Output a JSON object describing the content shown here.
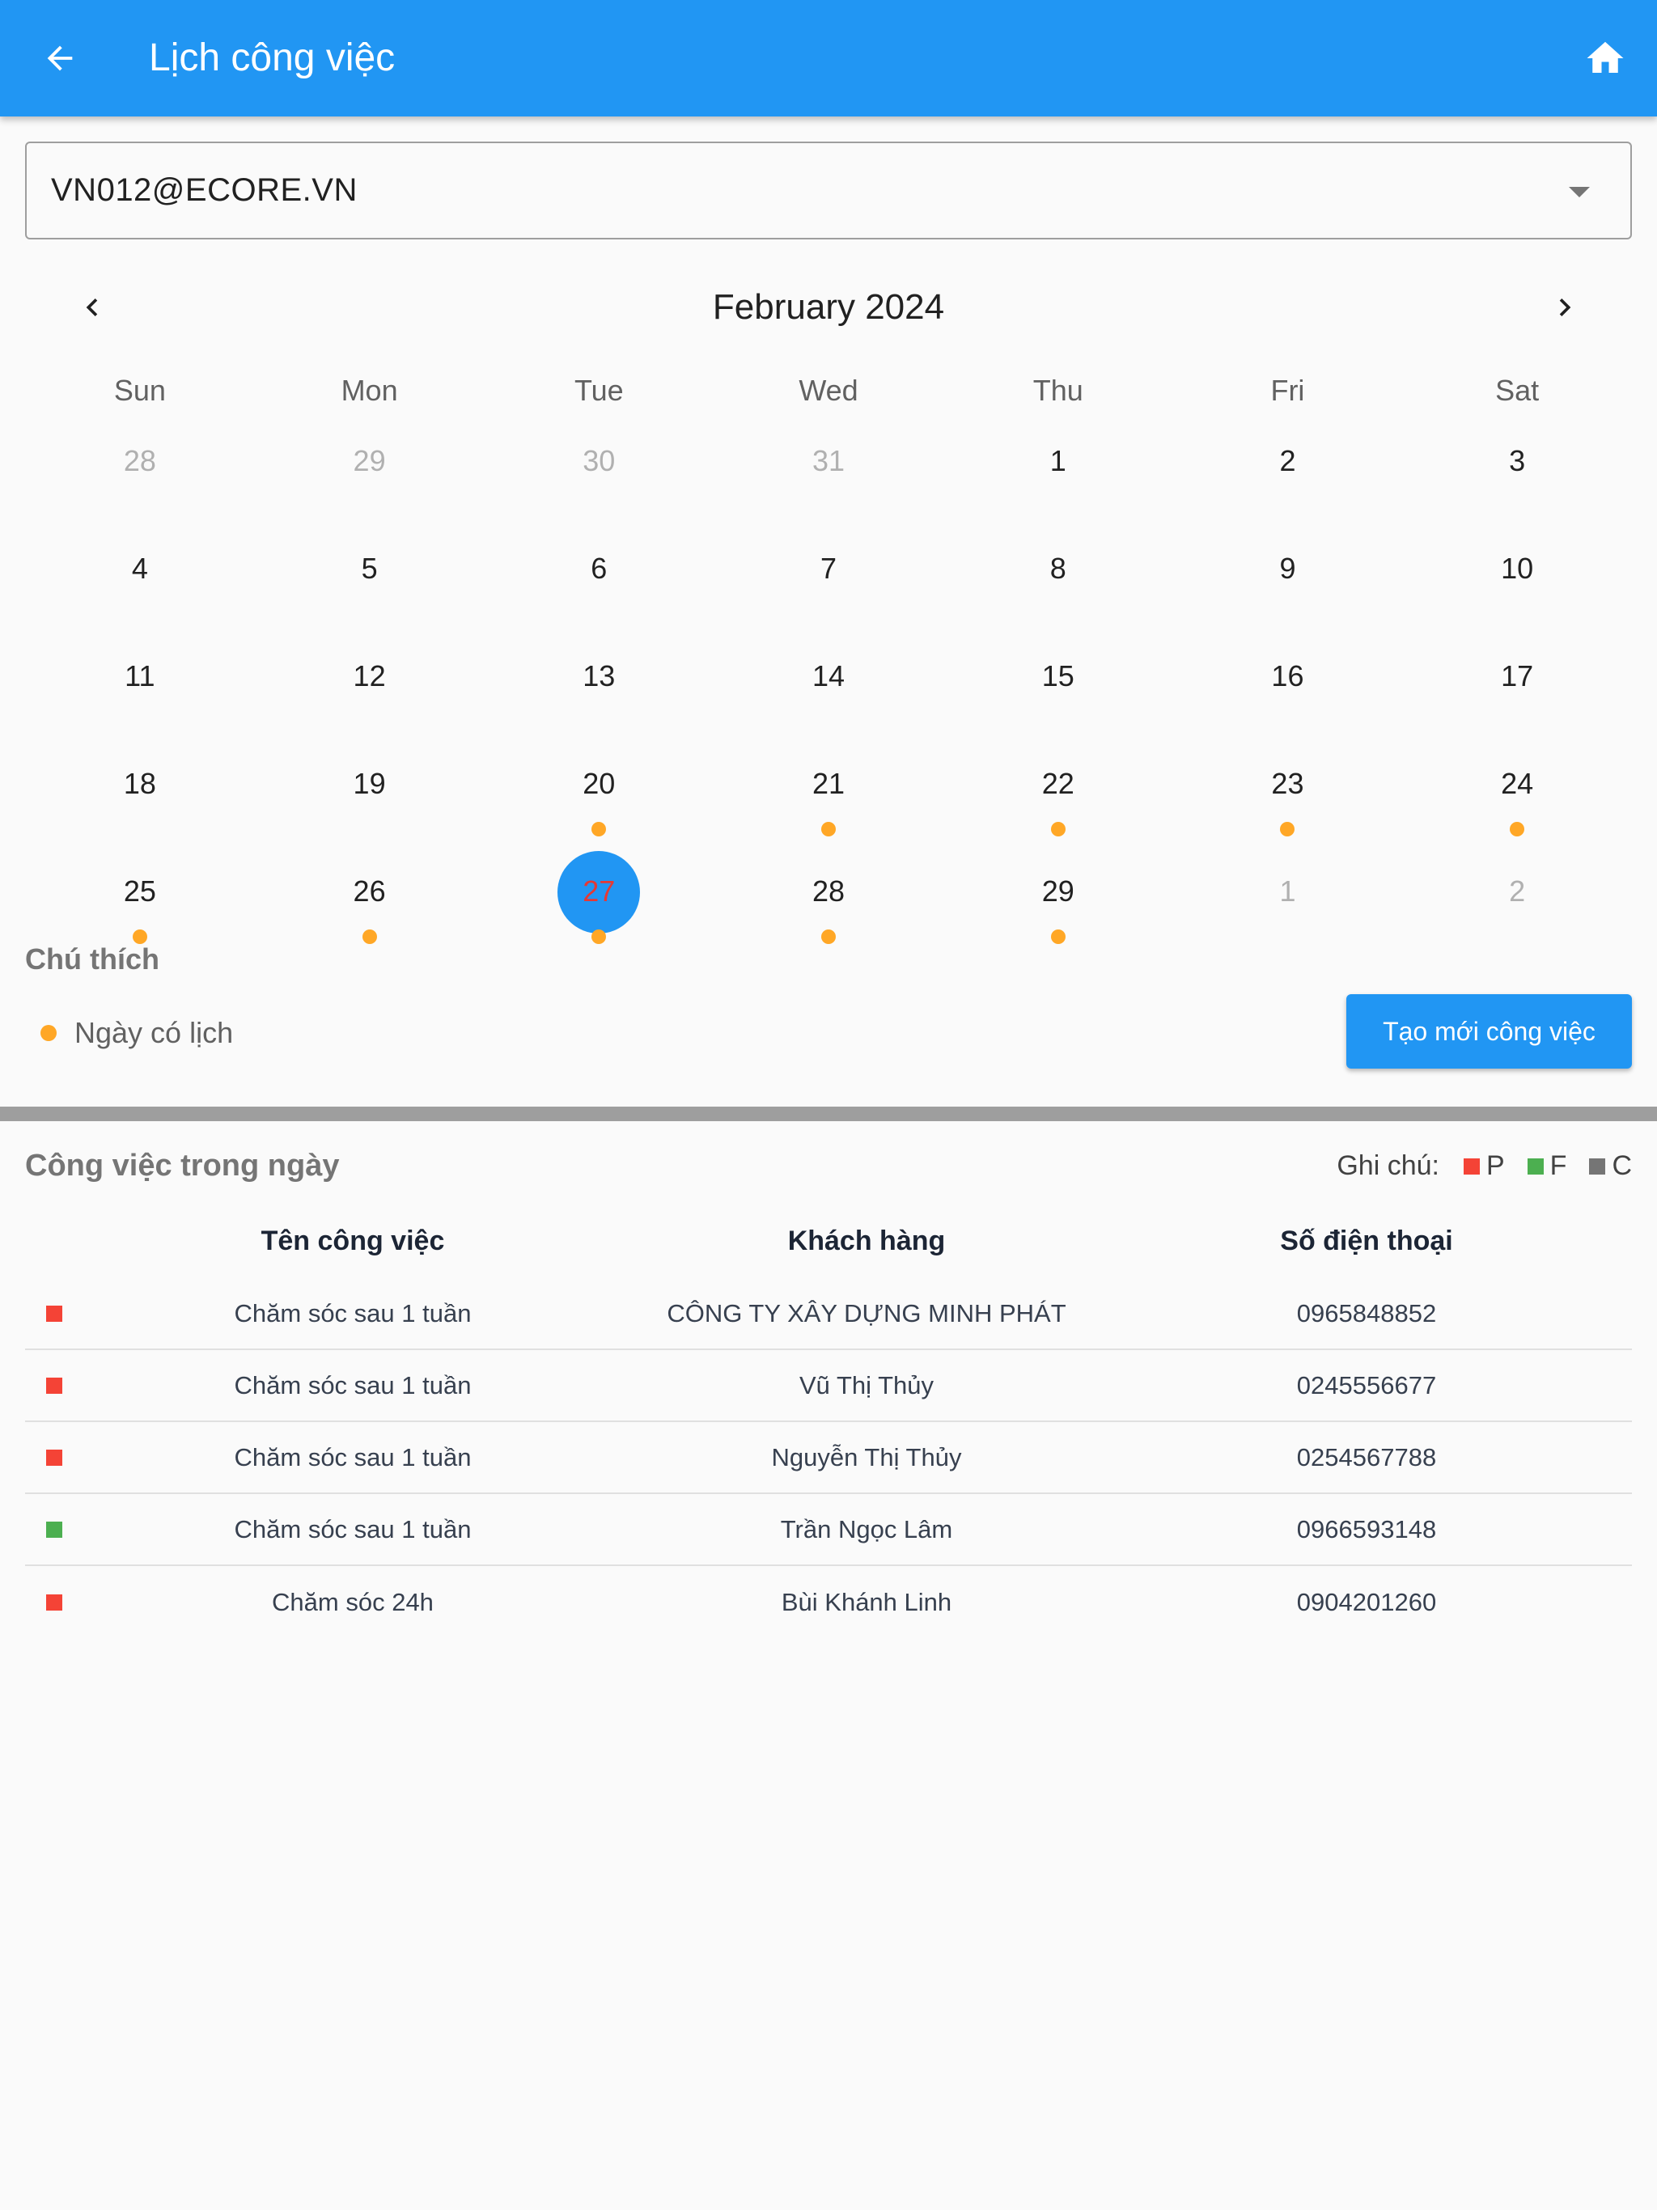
{
  "app_bar": {
    "title": "Lịch công việc",
    "back_icon": "arrow-back-icon",
    "home_icon": "home-icon",
    "background": "#2196F3"
  },
  "account_select": {
    "value": "VN012@ECORE.VN"
  },
  "calendar": {
    "month_label": "February 2024",
    "weekdays": [
      "Sun",
      "Mon",
      "Tue",
      "Wed",
      "Thu",
      "Fri",
      "Sat"
    ],
    "weeks": [
      [
        {
          "d": "28",
          "out": true
        },
        {
          "d": "29",
          "out": true
        },
        {
          "d": "30",
          "out": true
        },
        {
          "d": "31",
          "out": true
        },
        {
          "d": "1"
        },
        {
          "d": "2"
        },
        {
          "d": "3"
        }
      ],
      [
        {
          "d": "4"
        },
        {
          "d": "5"
        },
        {
          "d": "6"
        },
        {
          "d": "7"
        },
        {
          "d": "8"
        },
        {
          "d": "9"
        },
        {
          "d": "10"
        }
      ],
      [
        {
          "d": "11"
        },
        {
          "d": "12"
        },
        {
          "d": "13"
        },
        {
          "d": "14"
        },
        {
          "d": "15"
        },
        {
          "d": "16"
        },
        {
          "d": "17"
        }
      ],
      [
        {
          "d": "18"
        },
        {
          "d": "19"
        },
        {
          "d": "20",
          "event": true
        },
        {
          "d": "21",
          "event": true
        },
        {
          "d": "22",
          "event": true
        },
        {
          "d": "23",
          "event": true
        },
        {
          "d": "24",
          "event": true
        }
      ],
      [
        {
          "d": "25",
          "event": true
        },
        {
          "d": "26",
          "event": true
        },
        {
          "d": "27",
          "event": true,
          "selected": true
        },
        {
          "d": "28",
          "event": true
        },
        {
          "d": "29",
          "event": true
        },
        {
          "d": "1",
          "out": true
        },
        {
          "d": "2",
          "out": true
        }
      ]
    ],
    "event_dot_color": "#FFA726",
    "selected_color": "#2196F3"
  },
  "legend": {
    "title": "Chú thích",
    "item_label": "Ngày có lịch"
  },
  "create_button": {
    "label": "Tạo mới công việc"
  },
  "tasks": {
    "title": "Công việc trong ngày",
    "notes_label": "Ghi chú:",
    "status_codes": [
      {
        "code": "P",
        "color": "#F44336"
      },
      {
        "code": "F",
        "color": "#4CAF50"
      },
      {
        "code": "C",
        "color": "#757575"
      }
    ],
    "columns": [
      "Tên công việc",
      "Khách hàng",
      "Số điện thoại"
    ],
    "rows": [
      {
        "status": "P",
        "name": "Chăm sóc sau 1 tuần",
        "customer": "CÔNG TY XÂY DỰNG MINH PHÁT",
        "phone": "0965848852"
      },
      {
        "status": "P",
        "name": "Chăm sóc sau 1 tuần",
        "customer": "Vũ Thị Thủy",
        "phone": "0245556677"
      },
      {
        "status": "P",
        "name": "Chăm sóc sau 1 tuần",
        "customer": "Nguyễn Thị Thủy",
        "phone": "0254567788"
      },
      {
        "status": "F",
        "name": "Chăm sóc sau 1 tuần",
        "customer": "Trần Ngọc Lâm",
        "phone": "0966593148"
      },
      {
        "status": "P",
        "name": "Chăm sóc 24h",
        "customer": "Bùi Khánh Linh",
        "phone": "0904201260"
      }
    ]
  }
}
